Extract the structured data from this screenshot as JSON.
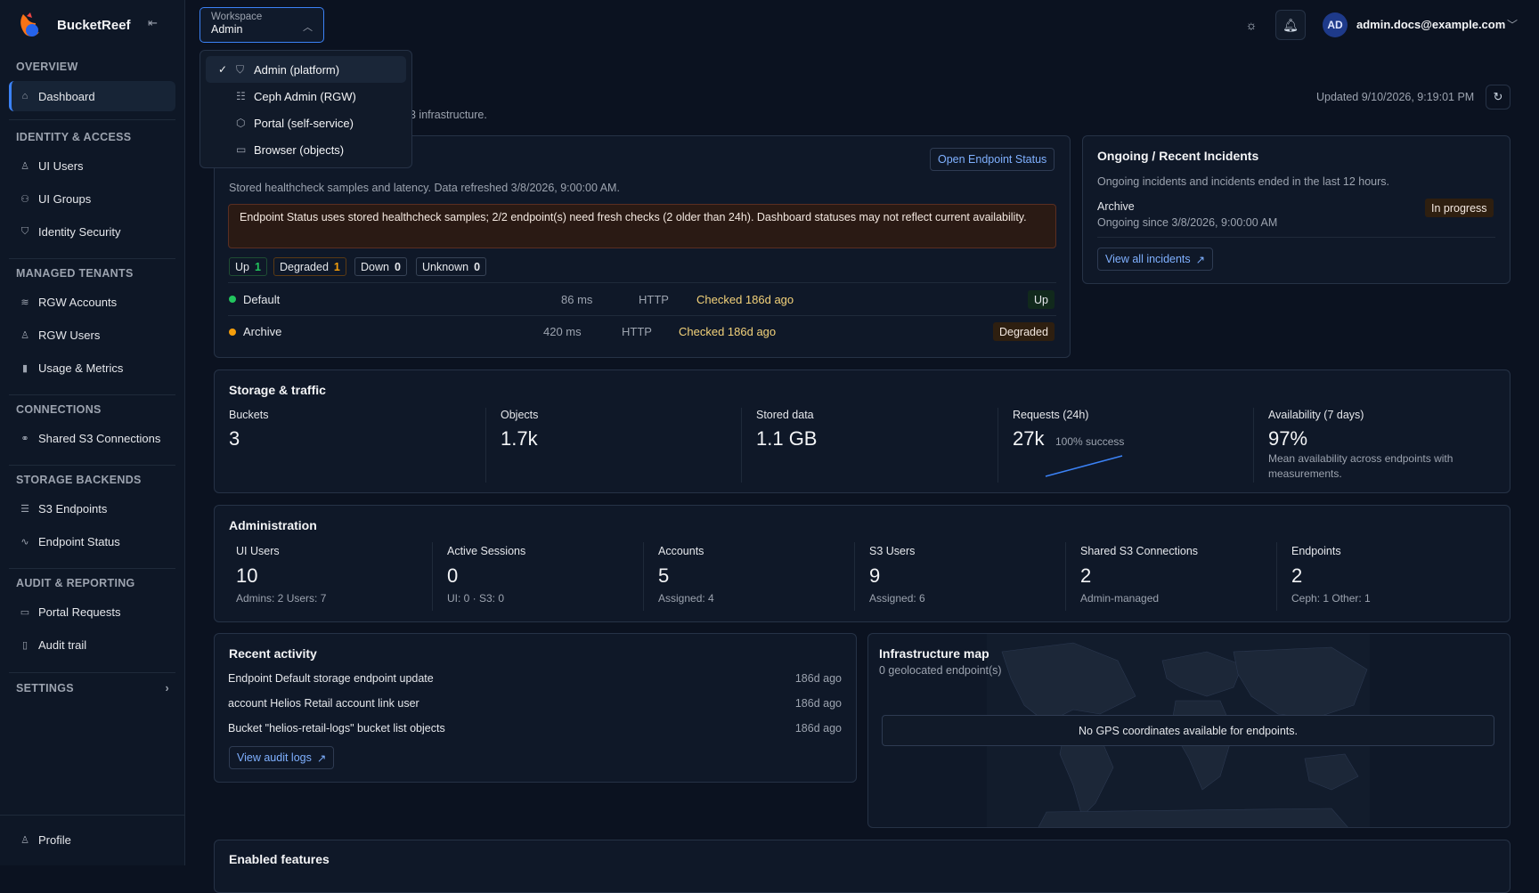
{
  "app": {
    "name": "BucketReef"
  },
  "sidebar": {
    "sections": {
      "overview": "OVERVIEW",
      "identity": "IDENTITY & ACCESS",
      "tenants": "MANAGED TENANTS",
      "connections": "CONNECTIONS",
      "storage": "STORAGE BACKENDS",
      "audit": "AUDIT & REPORTING",
      "settings": "SETTINGS"
    },
    "items": {
      "dashboard": "Dashboard",
      "ui_users": "UI Users",
      "ui_groups": "UI Groups",
      "identity_security": "Identity Security",
      "rgw_accounts": "RGW Accounts",
      "rgw_users": "RGW Users",
      "usage": "Usage & Metrics",
      "shared_s3": "Shared S3 Connections",
      "s3_endpoints": "S3 Endpoints",
      "endpoint_status": "Endpoint Status",
      "portal_requests": "Portal Requests",
      "audit_trail": "Audit trail",
      "profile": "Profile"
    }
  },
  "workspace": {
    "label": "Workspace",
    "value": "Admin",
    "options": [
      "Admin (platform)",
      "Ceph Admin (RGW)",
      "Portal (self-service)",
      "Browser (objects)"
    ]
  },
  "header": {
    "user_initials": "AD",
    "user_email": "admin.docs@example.com",
    "updated": "Updated 9/10/2026, 9:19:01 PM",
    "subtitle_fragment": "3 infrastructure."
  },
  "endpoint_status": {
    "open_button": "Open Endpoint Status",
    "desc": "Stored healthcheck samples and latency. Data refreshed 3/8/2026, 9:00:00 AM.",
    "warning": "Endpoint Status uses stored healthcheck samples; 2/2 endpoint(s) need fresh checks (2 older than 24h). Dashboard statuses may not reflect current availability.",
    "counts": [
      {
        "label": "Up",
        "value": "1"
      },
      {
        "label": "Degraded",
        "value": "1"
      },
      {
        "label": "Down",
        "value": "0"
      },
      {
        "label": "Unknown",
        "value": "0"
      }
    ],
    "rows": [
      {
        "name": "Default",
        "latency": "86 ms",
        "proto": "HTTP",
        "checked": "Checked 186d ago",
        "status": "Up"
      },
      {
        "name": "Archive",
        "latency": "420 ms",
        "proto": "HTTP",
        "checked": "Checked 186d ago",
        "status": "Degraded"
      }
    ]
  },
  "incidents": {
    "title": "Ongoing / Recent Incidents",
    "desc": "Ongoing incidents and incidents ended in the last 12 hours.",
    "name": "Archive",
    "since": "Ongoing since 3/8/2026, 9:00:00 AM",
    "status": "In progress",
    "link": "View all incidents"
  },
  "storage": {
    "title": "Storage & traffic",
    "stats": [
      {
        "label": "Buckets",
        "value": "3"
      },
      {
        "label": "Objects",
        "value": "1.7k"
      },
      {
        "label": "Stored data",
        "value": "1.1 GB"
      },
      {
        "label": "Requests (24h)",
        "value": "27k",
        "extra": "100% success"
      },
      {
        "label": "Availability (7 days)",
        "value": "97%",
        "extra": "Mean availability across endpoints with measurements."
      }
    ]
  },
  "admin": {
    "title": "Administration",
    "stats": [
      {
        "label": "UI Users",
        "value": "10",
        "sub": "Admins: 2 Users: 7"
      },
      {
        "label": "Active Sessions",
        "value": "0",
        "sub": "UI: 0 · S3: 0"
      },
      {
        "label": "Accounts",
        "value": "5",
        "sub": "Assigned: 4"
      },
      {
        "label": "S3 Users",
        "value": "9",
        "sub": "Assigned: 6"
      },
      {
        "label": "Shared S3 Connections",
        "value": "2",
        "sub": "Admin-managed"
      },
      {
        "label": "Endpoints",
        "value": "2",
        "sub": "Ceph: 1 Other: 1"
      }
    ]
  },
  "activity": {
    "title": "Recent activity",
    "items": [
      {
        "text": "Endpoint Default storage endpoint update",
        "ago": "186d ago"
      },
      {
        "text": "account Helios Retail account link user",
        "ago": "186d ago"
      },
      {
        "text": "Bucket \"helios-retail-logs\" bucket list objects",
        "ago": "186d ago"
      }
    ],
    "link": "View audit logs"
  },
  "map": {
    "title": "Infrastructure map",
    "subtitle": "0 geolocated endpoint(s)",
    "empty": "No GPS coordinates available for endpoints."
  },
  "features": {
    "title": "Enabled features"
  },
  "colors": {
    "accent": "#3b82f6",
    "up": "#22c55e",
    "degraded": "#f59e0b",
    "link": "#7fb0ff"
  }
}
